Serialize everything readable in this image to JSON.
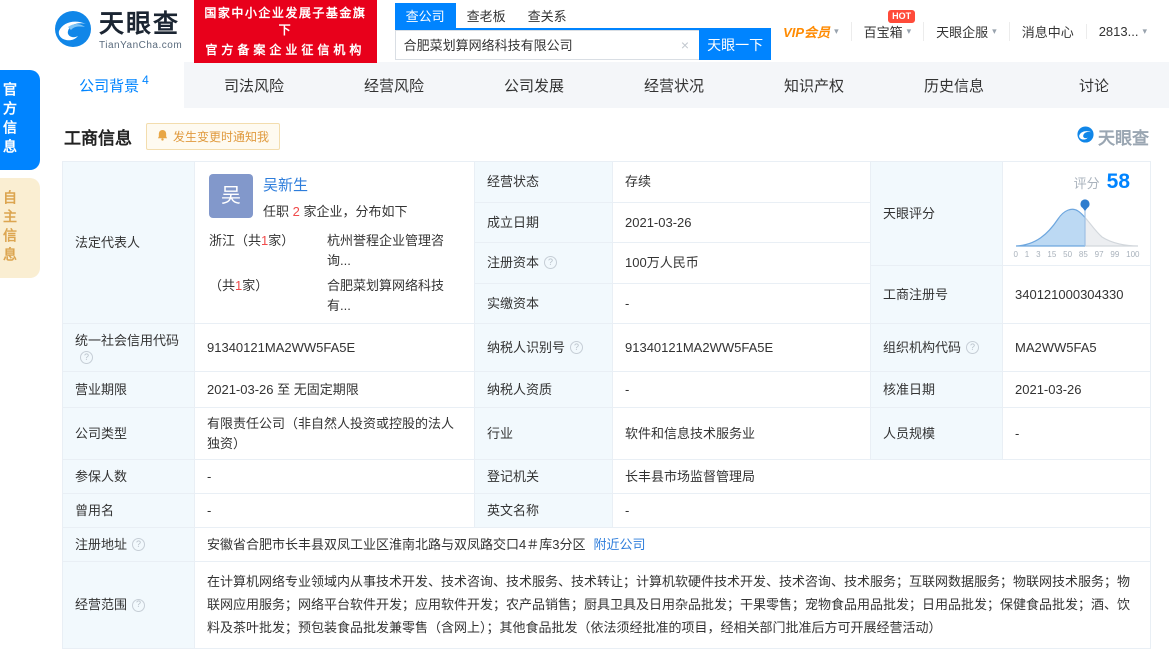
{
  "header": {
    "brand": "天眼查",
    "brand_domain": "TianYanCha.com",
    "badge_line1": "国家中小企业发展子基金旗下",
    "badge_line2": "官方备案企业征信机构",
    "search_tabs": {
      "company": "查公司",
      "boss": "查老板",
      "relation": "查关系"
    },
    "search_value": "合肥菜划算网络科技有限公司",
    "clear_icon": "×",
    "search_button": "天眼一下",
    "menu": {
      "vip": "VIP会员",
      "toolbox": "百宝箱",
      "hot": "HOT",
      "service": "天眼企服",
      "messages": "消息中心",
      "account": "2813...",
      "caret": "▾"
    }
  },
  "side_tabs": {
    "official": "官方信息",
    "self": "自主信息"
  },
  "nav": {
    "tabs": [
      {
        "label": "公司背景",
        "count": "4"
      },
      {
        "label": "司法风险"
      },
      {
        "label": "经营风险"
      },
      {
        "label": "公司发展"
      },
      {
        "label": "经营状况"
      },
      {
        "label": "知识产权"
      },
      {
        "label": "历史信息"
      },
      {
        "label": "讨论"
      }
    ]
  },
  "section": {
    "title": "工商信息",
    "notify": "发生变更时通知我",
    "watermark": "天眼查"
  },
  "legal": {
    "label": "法定代表人",
    "avatar_char": "吴",
    "name": "吴新生",
    "serve_pre": "任职 ",
    "serve_num": "2",
    "serve_post": " 家企业，分布如下",
    "dist": [
      {
        "pre": "浙江（共",
        "num": "1",
        "post": "家）",
        "company": "杭州誉程企业管理咨询..."
      },
      {
        "pre": "（共",
        "num": "1",
        "post": "家）",
        "company": "合肥菜划算网络科技有..."
      }
    ]
  },
  "fields": {
    "status": {
      "label": "经营状态",
      "value": "存续"
    },
    "est": {
      "label": "成立日期",
      "value": "2021-03-26"
    },
    "reg_capital": {
      "label": "注册资本",
      "value": "100万人民币"
    },
    "paid_capital": {
      "label": "实缴资本",
      "value": "-"
    },
    "score": {
      "label": "天眼评分"
    },
    "reg_no": {
      "label": "工商注册号",
      "value": "340121000304330"
    },
    "credit_code": {
      "label": "统一社会信用代码",
      "value": "91340121MA2WW5FA5E"
    },
    "tax_id": {
      "label": "纳税人识别号",
      "value": "91340121MA2WW5FA5E"
    },
    "org_code": {
      "label": "组织机构代码",
      "value": "MA2WW5FA5"
    },
    "term": {
      "label": "营业期限",
      "value": "2021-03-26 至 无固定期限"
    },
    "tax_quali": {
      "label": "纳税人资质",
      "value": "-"
    },
    "approve_date": {
      "label": "核准日期",
      "value": "2021-03-26"
    },
    "company_type": {
      "label": "公司类型",
      "value": "有限责任公司（非自然人投资或控股的法人独资）"
    },
    "industry": {
      "label": "行业",
      "value": "软件和信息技术服务业"
    },
    "staff_size": {
      "label": "人员规模",
      "value": "-"
    },
    "insured": {
      "label": "参保人数",
      "value": "-"
    },
    "authority": {
      "label": "登记机关",
      "value": "长丰县市场监督管理局"
    },
    "former_name": {
      "label": "曾用名",
      "value": "-"
    },
    "english_name": {
      "label": "英文名称",
      "value": "-"
    },
    "address": {
      "label": "注册地址",
      "value": "安徽省合肥市长丰县双凤工业区淮南北路与双凤路交口4＃库3分区",
      "link": "附近公司"
    },
    "scope": {
      "label": "经营范围",
      "value": "在计算机网络专业领域内从事技术开发、技术咨询、技术服务、技术转让；计算机软硬件技术开发、技术咨询、技术服务；互联网数据服务；物联网技术服务；物联网应用服务；网络平台软件开发；应用软件开发；农产品销售；厨具卫具及日用杂品批发；干果零售；宠物食品用品批发；日用品批发；保健食品批发；酒、饮料及茶叶批发；预包装食品批发兼零售（含网上）；其他食品批发（依法须经批准的项目，经相关部门批准后方可开展经营活动）"
    }
  },
  "score_chart": {
    "type": "area",
    "label": "评分",
    "score": "58",
    "axis": [
      "0",
      "1",
      "3",
      "15",
      "50",
      "85",
      "97",
      "99",
      "100"
    ]
  },
  "colors": {
    "accent": "#0084ff",
    "red_badge": "#e8001b",
    "orange": "#ff8a00",
    "label_bg": "#f2f9fd",
    "link": "#2e7ddb"
  }
}
